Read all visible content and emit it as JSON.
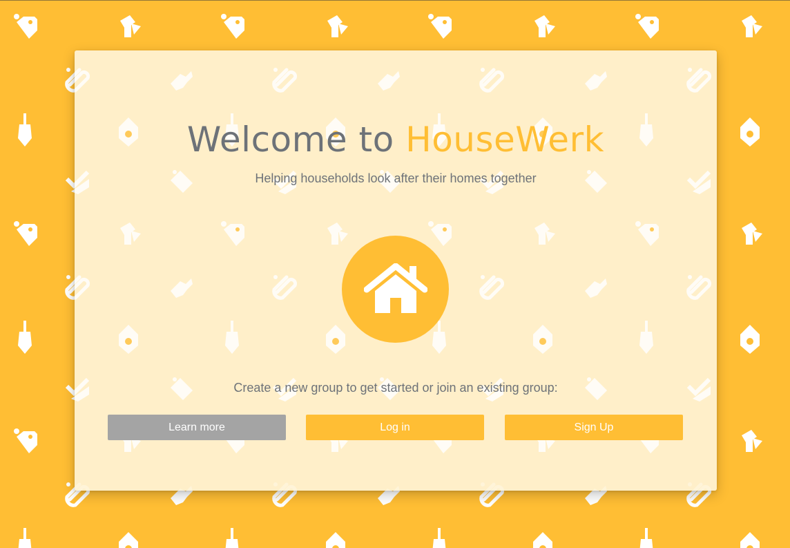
{
  "colors": {
    "background": "#FFBE34",
    "card": "#FFF3D6",
    "accent": "#FFBE34",
    "text": "#6D7278",
    "secondary_button": "#A4A4A4",
    "button_text": "#FFFFFF"
  },
  "background_pattern": {
    "icons": [
      "tag-icon",
      "dustpan-icon",
      "sponge-icon",
      "spray-bottle-icon",
      "broom-icon",
      "detergent-icon",
      "washing-machine-icon",
      "tick-wipe-icon"
    ]
  },
  "welcome": {
    "title_prefix": "Welcome to ",
    "title_brand": "HouseWerk",
    "subtitle": "Helping households look after their homes together",
    "logo_icon": "house-icon",
    "prompt": "Create a new group to get started or join an existing group:"
  },
  "actions": {
    "learn_more": "Learn more",
    "log_in": "Log in",
    "sign_up": "Sign Up"
  }
}
